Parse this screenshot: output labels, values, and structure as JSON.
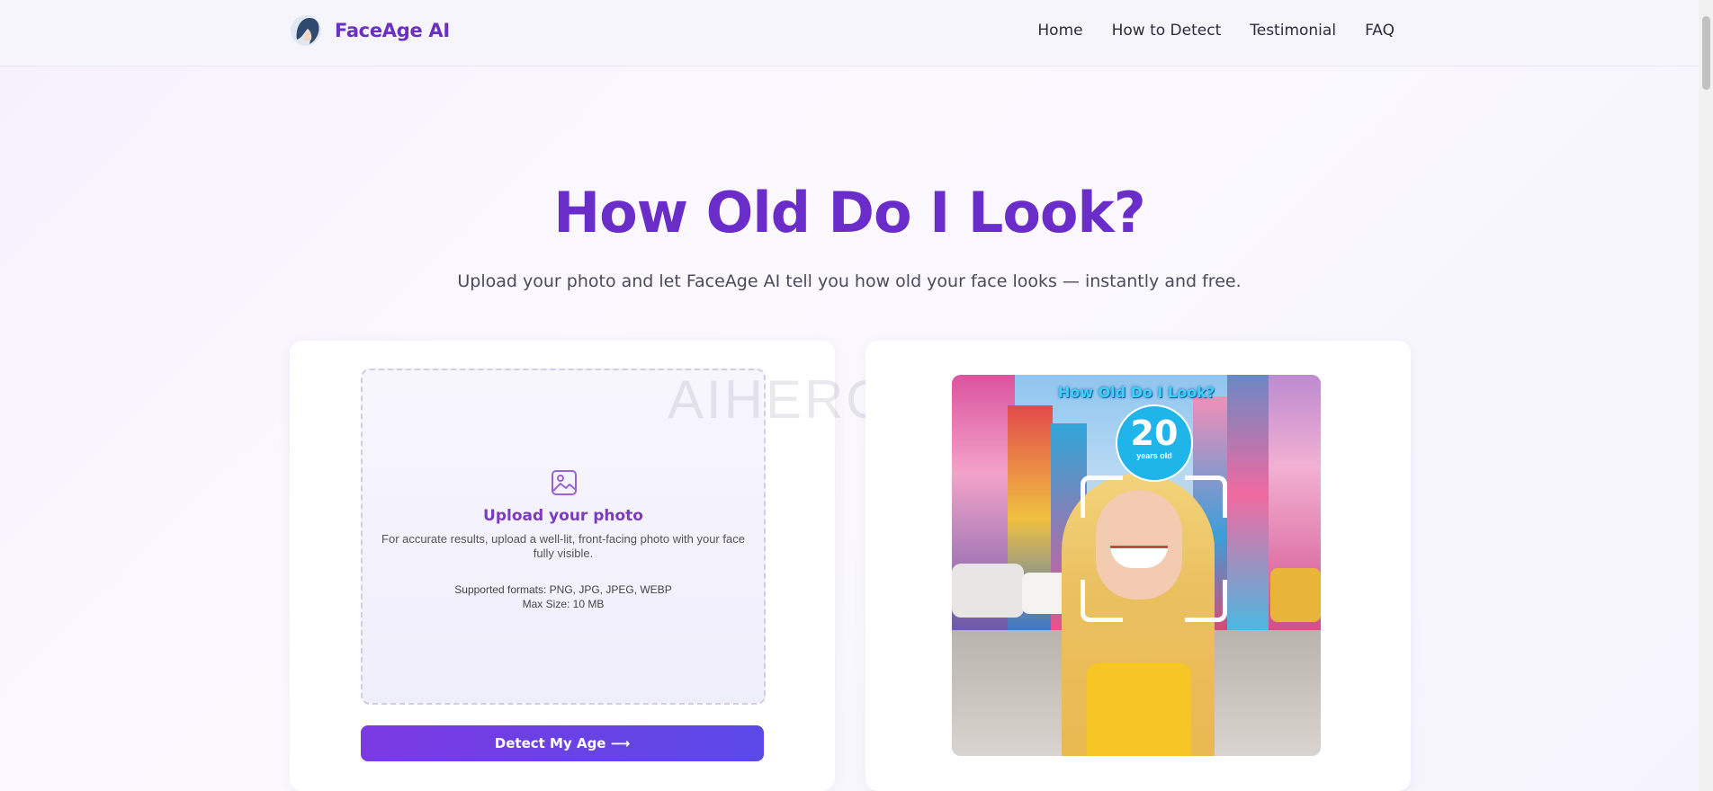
{
  "header": {
    "brand": "FaceAge AI",
    "nav": [
      {
        "label": "Home"
      },
      {
        "label": "How to Detect"
      },
      {
        "label": "Testimonial"
      },
      {
        "label": "FAQ"
      }
    ]
  },
  "hero": {
    "title": "How Old Do I Look?",
    "subtitle": "Upload your photo and let FaceAge AI tell you how old your face looks — instantly and free."
  },
  "upload": {
    "icon": "image-icon",
    "title": "Upload your photo",
    "description": "For accurate results, upload a well-lit, front-facing photo with your face fully visible.",
    "formats": "Supported formats: PNG, JPG, JPEG, WEBP",
    "max_size": "Max Size: 10 MB",
    "button": "Detect My Age ⟶"
  },
  "watermark": "AIHERON.C",
  "example": {
    "banner": "How Old Do I Look?",
    "age": "20",
    "age_unit": "years old"
  },
  "colors": {
    "brand": "#6a2dc9",
    "button_start": "#7b39e3",
    "button_end": "#5a49e6",
    "age_badge": "#1fb5e8"
  }
}
